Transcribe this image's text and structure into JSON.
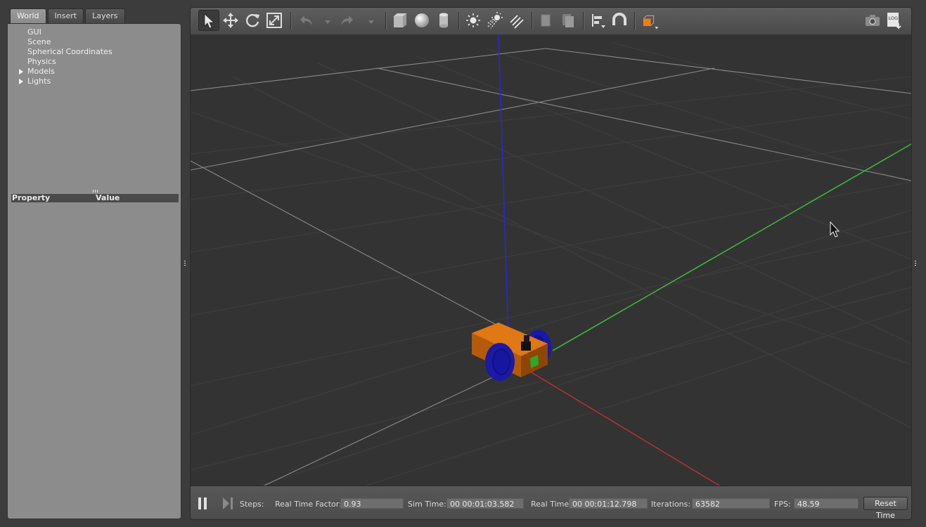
{
  "left_panel": {
    "tabs": [
      {
        "label": "World",
        "active": true
      },
      {
        "label": "Insert",
        "active": false
      },
      {
        "label": "Layers",
        "active": false
      }
    ],
    "tree": [
      {
        "label": "GUI",
        "expandable": false
      },
      {
        "label": "Scene",
        "expandable": false
      },
      {
        "label": "Spherical Coordinates",
        "expandable": false
      },
      {
        "label": "Physics",
        "expandable": false
      },
      {
        "label": "Models",
        "expandable": true
      },
      {
        "label": "Lights",
        "expandable": true
      }
    ],
    "properties": {
      "col_property": "Property",
      "col_value": "Value"
    }
  },
  "toolbar": {
    "icons": [
      "select-icon",
      "translate-icon",
      "rotate-icon",
      "scale-icon",
      "undo-icon",
      "undo-dropdown-icon",
      "redo-icon",
      "redo-dropdown-icon",
      "box-icon",
      "sphere-icon",
      "cylinder-icon",
      "point-light-icon",
      "spot-light-icon",
      "directional-light-icon",
      "copy-icon",
      "paste-icon",
      "align-icon",
      "snap-magnet-icon",
      "view-angle-icon",
      "screenshot-icon",
      "log-icon"
    ],
    "active": "select-icon",
    "log_text": "LOG"
  },
  "bottom_bar": {
    "steps_label": "Steps:",
    "steps_value": "",
    "real_time_factor_label": "Real Time Factor:",
    "real_time_factor_value": "0.93",
    "sim_time_label": "Sim Time:",
    "sim_time_value": "00 00:01:03.582",
    "real_time_label": "Real Time:",
    "real_time_value": "00 00:01:12.798",
    "iterations_label": "Iterations:",
    "iterations_value": "63582",
    "fps_label": "FPS:",
    "fps_value": "48.59",
    "reset_time_label": "Reset Time"
  },
  "colors": {
    "panel_bg": "#8c8c8c",
    "viewport_bg": "#333333",
    "chassis": "#c8650f",
    "wheels": "#1a1aa6",
    "axis_x": "#c33030",
    "axis_y": "#3cb43c",
    "axis_z": "#2828d2"
  }
}
